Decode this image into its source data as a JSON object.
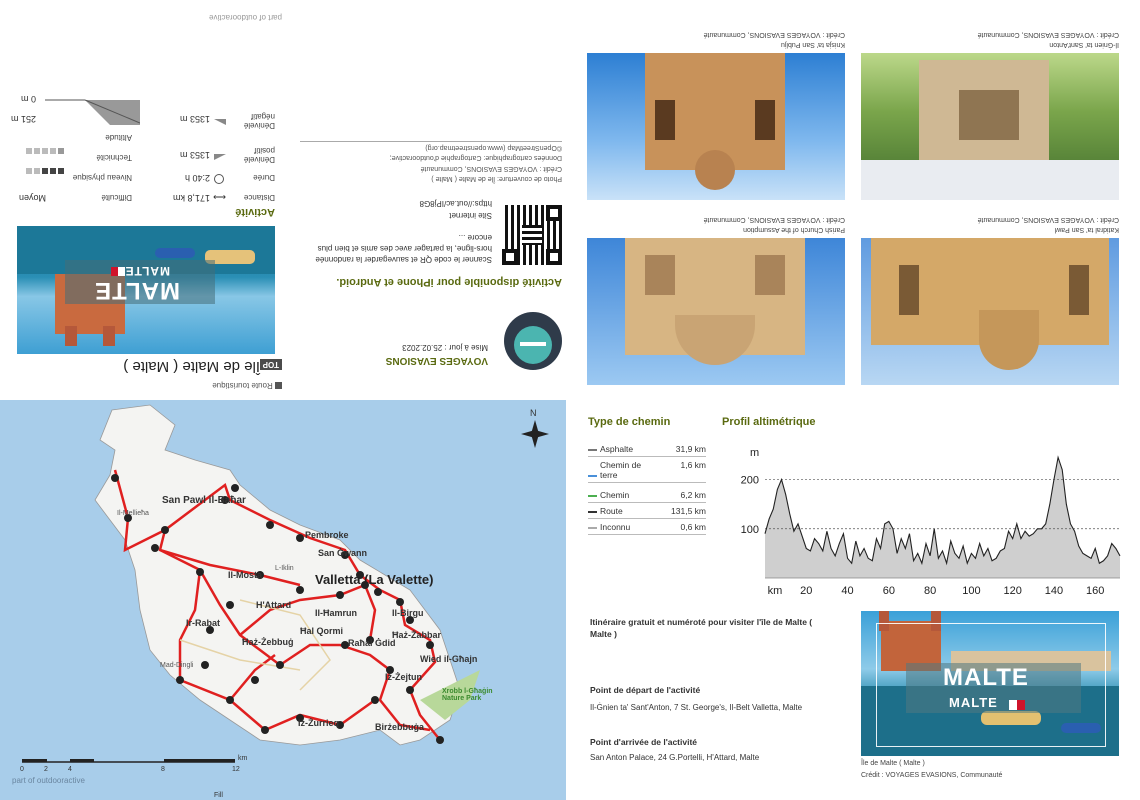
{
  "top_left_panel": {
    "part_of_text": "part of outdooractive",
    "badge_top": "TOP",
    "title": "Île de Malte ( Malte )",
    "category": "Route touristique",
    "cover_text": "MALTE",
    "cover_text_2": "MALTE",
    "activity_heading": "Activité",
    "stats": {
      "distance_label": "Distance",
      "distance_value": "171,8 km",
      "duration_label": "Durée",
      "duration_value": "2:40 h",
      "elev_pos_label": "Dénivelé positif",
      "elev_pos_value": "1353 m",
      "elev_neg_label": "Dénivelé négatif",
      "elev_neg_value": "1353 m",
      "difficulty_label": "Difficulté",
      "difficulty_value": "Moyen",
      "fitness_label": "Niveau physique",
      "technique_label": "Technicité",
      "altitude_label": "Altitude",
      "alt_max": "251 m",
      "alt_min": "0 m"
    }
  },
  "top_middle_panel": {
    "author": "VOYAGES EVASIONS",
    "updated": "Mise à jour : 25.02.2023",
    "app_heading": "Activité disponible pour iPhone et Android.",
    "qr_text": "Scanner le code QR et sauvegarder la randonnée hors-ligne, la partager avec des amis et bien plus encore ...",
    "site_label": "Site internet",
    "site_url": "https://out.ac/IPj8G8",
    "cover_credit": "Photo de couverture: Île de Malte ( Malte )",
    "cover_credit_2": "Crédit : VOYAGES EVASIONS, Communauté",
    "map_credit": "Données cartographique: Cartographie d'outdooractive; ©OpenStreetMap (www.openstreetmap.org)"
  },
  "photos_top": [
    {
      "caption": "Knisja ta' San Publju",
      "credit": "Crédit : VOYAGES EVASIONS, Communauté"
    },
    {
      "caption": "Il-Ġnien ta' Sant'Anton",
      "credit": "Crédit : VOYAGES EVASIONS, Communauté"
    },
    {
      "caption": "Parish Church of the Assumption",
      "credit": "Crédit : VOYAGES EVASIONS, Communauté"
    },
    {
      "caption": "Katidral ta' San Pawl",
      "credit": "Crédit : VOYAGES EVASIONS, Communauté"
    }
  ],
  "map": {
    "north": "N",
    "places": [
      "San Pawl il-Baħar",
      "Il-Mellieħa",
      "Pembroke",
      "San Ġwann",
      "Il-Mosta",
      "L-Iklin",
      "Valletta (La Valette)",
      "H'Attard",
      "Il-Ħamrun",
      "Il-Birgu",
      "Ir-Rabat",
      "Ħaż-Żebbuġ",
      "Ħal Qormi",
      "Ħaż-Żabbar",
      "Raħal Ġdid",
      "Wied il-Għajn",
      "Mad-Dingli",
      "Iż-Żejtun",
      "Iż-Żurrieq",
      "Birżebbuġa",
      "Xrobb l-Għaġin Nature Park"
    ],
    "scale_ticks": [
      "0",
      "2",
      "4",
      "8",
      "12"
    ],
    "scale_unit": "km",
    "part_of_text": "part of outdooractive",
    "page_label": "Fill"
  },
  "path_types": {
    "title": "Type de chemin",
    "rows": [
      {
        "label": "Asphalte",
        "value": "31,9 km",
        "color": "#777777"
      },
      {
        "label": "Chemin de terre",
        "value": "1,6 km",
        "color": "#4a90d9"
      },
      {
        "label": "Chemin",
        "value": "6,2 km",
        "color": "#4caf50"
      },
      {
        "label": "Route",
        "value": "131,5 km",
        "color": "#333333"
      },
      {
        "label": "Inconnu",
        "value": "0,6 km",
        "color": "#aaaaaa"
      }
    ]
  },
  "chart_data": {
    "type": "area",
    "title": "Profil altimétrique",
    "ylabel": "m",
    "xlabel": "km",
    "ylim": [
      0,
      260
    ],
    "xlim": [
      0,
      172
    ],
    "yticks": [
      100,
      200
    ],
    "xticks": [
      20,
      40,
      60,
      80,
      100,
      120,
      140,
      160
    ],
    "x": [
      0,
      2,
      4,
      6,
      8,
      10,
      12,
      14,
      16,
      18,
      20,
      22,
      24,
      26,
      28,
      30,
      32,
      34,
      36,
      38,
      40,
      42,
      44,
      46,
      48,
      50,
      52,
      54,
      56,
      58,
      60,
      62,
      64,
      66,
      68,
      70,
      72,
      74,
      76,
      78,
      80,
      82,
      84,
      86,
      88,
      90,
      92,
      94,
      96,
      98,
      100,
      102,
      104,
      106,
      108,
      110,
      112,
      114,
      116,
      118,
      120,
      122,
      124,
      126,
      128,
      130,
      132,
      134,
      136,
      138,
      140,
      142,
      144,
      146,
      148,
      150,
      152,
      154,
      156,
      158,
      160,
      162,
      164,
      166,
      168,
      170,
      172
    ],
    "y": [
      90,
      120,
      140,
      180,
      200,
      170,
      130,
      95,
      110,
      85,
      60,
      55,
      80,
      70,
      55,
      95,
      60,
      45,
      70,
      90,
      40,
      30,
      75,
      45,
      60,
      40,
      35,
      80,
      60,
      110,
      115,
      100,
      50,
      80,
      60,
      90,
      35,
      50,
      30,
      70,
      45,
      100,
      40,
      55,
      30,
      75,
      50,
      40,
      65,
      30,
      50,
      40,
      70,
      45,
      60,
      35,
      40,
      55,
      60,
      95,
      80,
      110,
      80,
      95,
      85,
      90,
      100,
      100,
      110,
      150,
      200,
      245,
      220,
      150,
      110,
      95,
      65,
      50,
      45,
      40,
      60,
      30,
      35,
      45,
      70,
      60,
      45
    ]
  },
  "info": {
    "itinerary": "Itinéraire gratuit et numéroté pour visiter l'île de Malte ( Malte )",
    "start_label": "Point de départ de l'activité",
    "start_value": "Il-Ġnien ta' Sant'Anton, 7 St. George's, Il-Belt Valletta, Malte",
    "end_label": "Point d'arrivée de l'activité",
    "end_value": "San Anton Palace, 24 G.Portelli, H'Attard, Malte",
    "photo_text": "MALTE",
    "photo_text_2": "MALTE",
    "photo_caption": "Île de Malte ( Malte )",
    "photo_credit": "Crédit : VOYAGES EVASIONS, Communauté"
  }
}
